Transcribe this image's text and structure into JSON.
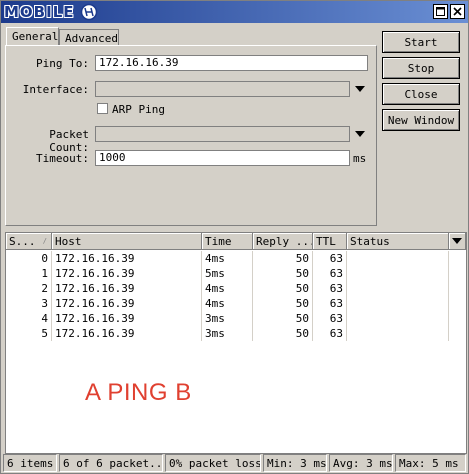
{
  "window": {
    "logo_text": "MOBILE",
    "title_buttons": {
      "maximize": "□",
      "close": "×"
    }
  },
  "tabs": [
    {
      "label": "General",
      "active": true
    },
    {
      "label": "Advanced",
      "active": false
    }
  ],
  "form": {
    "ping_to": {
      "label": "Ping To:",
      "value": "172.16.16.39"
    },
    "interface": {
      "label": "Interface:",
      "value": ""
    },
    "arp_ping": {
      "label": "ARP Ping",
      "checked": false
    },
    "packet_count": {
      "label": "Packet Count:",
      "value": ""
    },
    "timeout": {
      "label": "Timeout:",
      "value": "1000",
      "unit": "ms"
    }
  },
  "buttons": {
    "start": "Start",
    "stop": "Stop",
    "close": "Close",
    "new_window": "New Window"
  },
  "table": {
    "columns": [
      "S...",
      "Host",
      "Time",
      "Reply ...",
      "TTL",
      "Status"
    ],
    "sort_indicator": "/",
    "rows": [
      {
        "seq": "0",
        "host": "172.16.16.39",
        "time": "4ms",
        "reply": "50",
        "ttl": "63",
        "status": ""
      },
      {
        "seq": "1",
        "host": "172.16.16.39",
        "time": "5ms",
        "reply": "50",
        "ttl": "63",
        "status": ""
      },
      {
        "seq": "2",
        "host": "172.16.16.39",
        "time": "4ms",
        "reply": "50",
        "ttl": "63",
        "status": ""
      },
      {
        "seq": "3",
        "host": "172.16.16.39",
        "time": "4ms",
        "reply": "50",
        "ttl": "63",
        "status": ""
      },
      {
        "seq": "4",
        "host": "172.16.16.39",
        "time": "3ms",
        "reply": "50",
        "ttl": "63",
        "status": ""
      },
      {
        "seq": "5",
        "host": "172.16.16.39",
        "time": "3ms",
        "reply": "50",
        "ttl": "63",
        "status": ""
      }
    ]
  },
  "annotation": {
    "text": "A PING B",
    "color": "#e04030"
  },
  "statusbar": {
    "items": "6 items",
    "packets": "6 of 6 packet...",
    "loss": "0% packet loss",
    "min": "Min: 3 ms",
    "avg": "Avg: 3 ms",
    "max": "Max: 5 ms"
  },
  "colors": {
    "title_bar_start": "#1c3a8c",
    "title_bar_end": "#6a8fd4",
    "chrome": "#d4d0c8"
  }
}
